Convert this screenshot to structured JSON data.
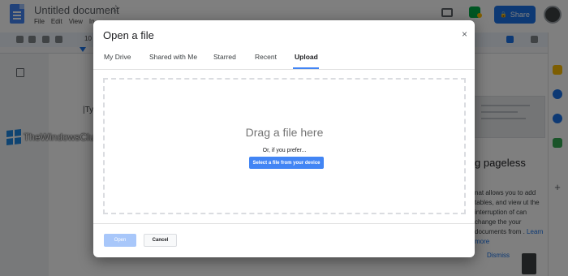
{
  "app": {
    "doc_title": "Untitled document",
    "menus": [
      "File",
      "Edit",
      "View",
      "In"
    ],
    "share_label": "Share",
    "zoom_fragment": "10"
  },
  "doc": {
    "cursor_text": "|Ty"
  },
  "promo": {
    "title": "g pageless",
    "body": "nat allows you to add tables, and view ut the interruption of can change the your documents from .",
    "link": "Learn more",
    "dismiss": "Dismiss"
  },
  "watermark": {
    "text": "TheWindowsClub"
  },
  "dialog": {
    "title": "Open a file",
    "close_glyph": "×",
    "tabs": [
      {
        "label": "My Drive",
        "active": false
      },
      {
        "label": "Shared with Me",
        "active": false
      },
      {
        "label": "Starred",
        "active": false
      },
      {
        "label": "Recent",
        "active": false
      },
      {
        "label": "Upload",
        "active": true
      }
    ],
    "dropzone_title": "Drag a file here",
    "prefer_text": "Or, if you prefer...",
    "select_button": "Select a file from your device",
    "open_button": "Open",
    "cancel_button": "Cancel"
  },
  "colors": {
    "accent": "#4285f4",
    "share": "#1a73e8",
    "open_disabled": "#a8c7fa"
  }
}
